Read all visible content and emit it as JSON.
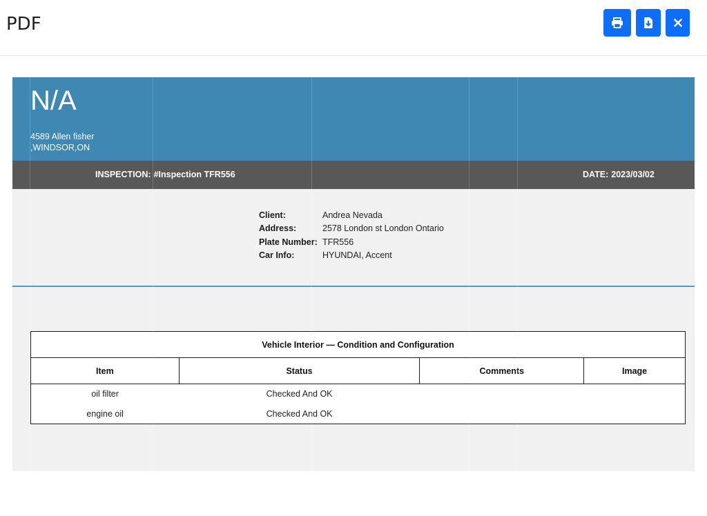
{
  "header": {
    "title": "PDF",
    "buttons": {
      "print": "printer-icon",
      "download": "file-download-icon",
      "close": "close-icon"
    },
    "accent_color": "#0d6efd"
  },
  "document": {
    "company_name": "N/A",
    "address_line1": "4589 Allen fisher",
    "address_line2": ",WINDSOR,ON",
    "inspection_label": "INSPECTION:",
    "inspection_value": "#Inspection TFR556",
    "date_label": "DATE:",
    "date_value": "2023/03/02",
    "colors": {
      "header_band": "#3f88b3",
      "sub_band": "#585858",
      "divider": "#4a9ad0"
    },
    "client_info": [
      {
        "label": "Client:",
        "value": "Andrea Nevada"
      },
      {
        "label": "Address:",
        "value": "2578 London st London Ontario"
      },
      {
        "label": "Plate Number:",
        "value": "TFR556"
      },
      {
        "label": "Car Info:",
        "value": "HYUNDAI, Accent"
      }
    ],
    "table": {
      "title": "Vehicle Interior — Condition and Configuration",
      "columns": [
        "Item",
        "Status",
        "Comments",
        "Image"
      ],
      "rows": [
        {
          "item": "oil filter",
          "status": "Checked And OK",
          "comments": "",
          "image": ""
        },
        {
          "item": "engine oil",
          "status": "Checked And OK",
          "comments": "",
          "image": ""
        }
      ]
    }
  }
}
